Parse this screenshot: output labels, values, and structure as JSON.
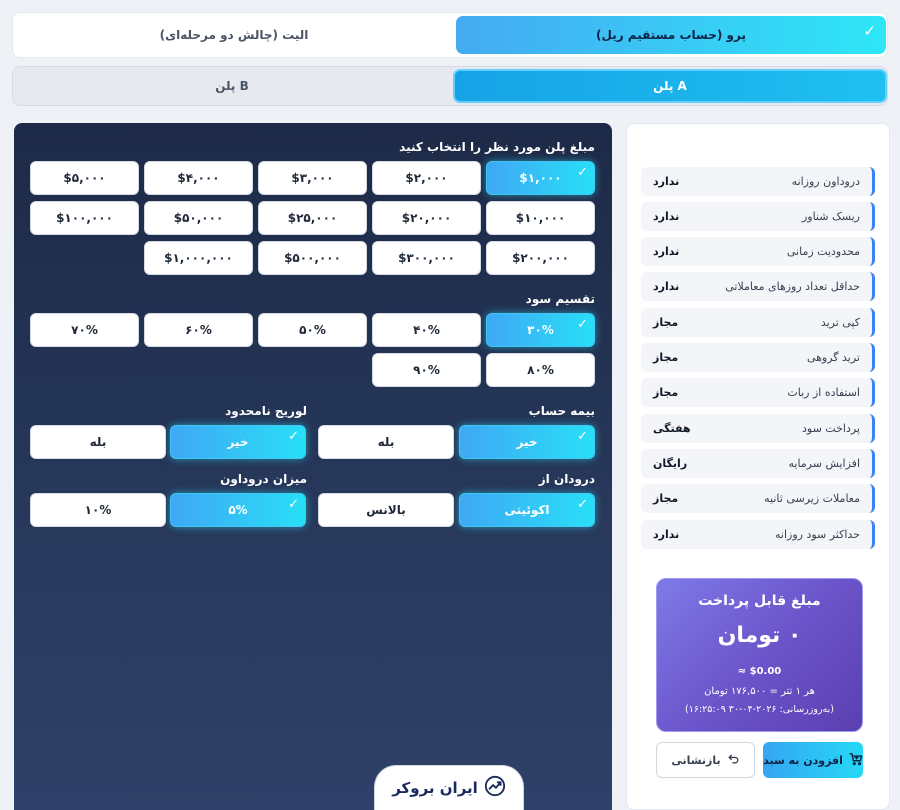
{
  "account_tabs": {
    "pro": "پرو (حساب مستقیم ریل)",
    "elite": "الیت (چالش دو مرحله‌ای)",
    "check": "✓"
  },
  "plan_tabs": {
    "a": "پلن A",
    "b": "پلن B"
  },
  "amount": {
    "title": "مبلغ پلن مورد نظر را انتخاب کنید",
    "options": [
      "$۱,۰۰۰",
      "$۲,۰۰۰",
      "$۳,۰۰۰",
      "$۴,۰۰۰",
      "$۵,۰۰۰",
      "$۱۰,۰۰۰",
      "$۲۰,۰۰۰",
      "$۲۵,۰۰۰",
      "$۵۰,۰۰۰",
      "$۱۰۰,۰۰۰",
      "$۲۰۰,۰۰۰",
      "$۳۰۰,۰۰۰",
      "$۵۰۰,۰۰۰",
      "$۱,۰۰۰,۰۰۰"
    ],
    "selected": "$۱,۰۰۰"
  },
  "profit_split": {
    "title": "تقسیم سود",
    "options": [
      "۳۰%",
      "۴۰%",
      "۵۰%",
      "۶۰%",
      "۷۰%",
      "۸۰%",
      "۹۰%"
    ],
    "selected": "۳۰%"
  },
  "insurance": {
    "title": "بیمه حساب",
    "options": [
      "خیر",
      "بله"
    ],
    "selected": "خیر"
  },
  "leverage": {
    "title": "لوریج نامحدود",
    "options": [
      "خیر",
      "بله"
    ],
    "selected": "خیر"
  },
  "drawdown_from": {
    "title": "درودان از",
    "options": [
      "اکوئیتی",
      "بالانس"
    ],
    "selected": "اکوئیتی"
  },
  "drawdown_amount": {
    "title": "میزان دروداون",
    "options": [
      "۵%",
      "۱۰%"
    ],
    "selected": "۵%"
  },
  "features": [
    {
      "label": "دروداون روزانه",
      "value": "ندارد"
    },
    {
      "label": "ریسک شناور",
      "value": "ندارد"
    },
    {
      "label": "محدودیت زمانی",
      "value": "ندارد"
    },
    {
      "label": "حداقل تعداد روزهای معاملاتی",
      "value": "ندارد"
    },
    {
      "label": "کپی ترید",
      "value": "مجاز"
    },
    {
      "label": "ترید گروهی",
      "value": "مجاز"
    },
    {
      "label": "استفاده از ربات",
      "value": "مجاز"
    },
    {
      "label": "پرداخت سود",
      "value": "هفتگی"
    },
    {
      "label": "افزایش سرمایه",
      "value": "رایگان"
    },
    {
      "label": "معاملات زیرسی ثانیه",
      "value": "مجاز"
    },
    {
      "label": "حداکثر سود روزانه",
      "value": "ندارد"
    }
  ],
  "price": {
    "title": "مبلغ قابل پرداخت",
    "value": "۰ تومان",
    "usd": "≈ $0.00",
    "rate": "هر ۱ تتر = ۱۷۶,۵۰۰ تومان",
    "updated": "(به‌روزرسانی: ۲۰۲۶-۰۴-۳۰ ۱۶:۲۵:۰۹)"
  },
  "buttons": {
    "add_to_cart": "افزودن به سبد",
    "reset": "بازنشانی"
  },
  "logo": {
    "text": "ایران بروکر"
  },
  "colors": {
    "accent": "#28dff6",
    "panel_dark": "#1d2a47",
    "card_purple": "#6a52c8"
  }
}
